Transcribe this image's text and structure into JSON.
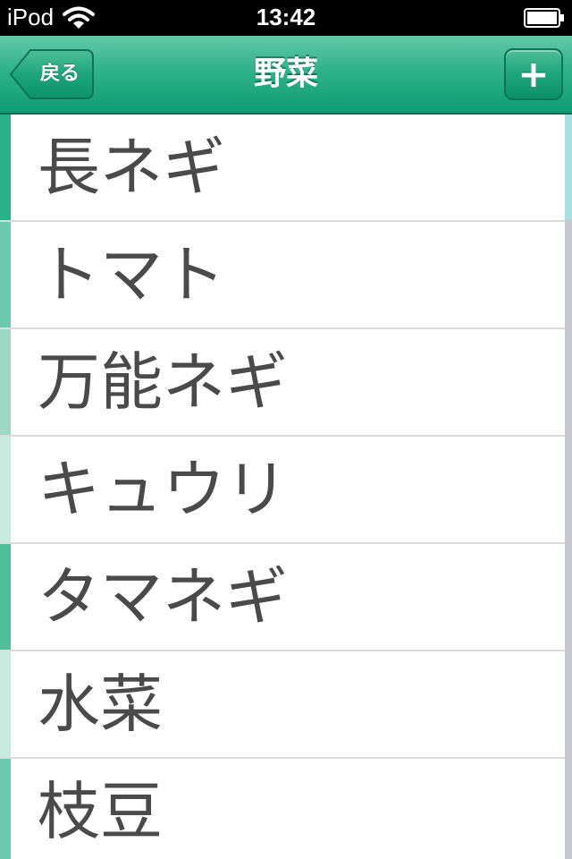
{
  "status_bar": {
    "carrier": "iPod",
    "time": "13:42",
    "icons": [
      "wifi-icon",
      "battery-icon"
    ]
  },
  "nav": {
    "title": "野菜",
    "back_label": "戻る",
    "add_icon": "plus-icon"
  },
  "list": {
    "items": [
      {
        "label": "長ネギ",
        "color": "#25b387"
      },
      {
        "label": "トマト",
        "color": "#6bc9ad"
      },
      {
        "label": "万能ネギ",
        "color": "#9ed9c6"
      },
      {
        "label": "キュウリ",
        "color": "#c8ebe0"
      },
      {
        "label": "タマネギ",
        "color": "#4fbe99"
      },
      {
        "label": "水菜",
        "color": "#c8ebe0"
      },
      {
        "label": "枝豆",
        "color": "#6bc9ad"
      }
    ]
  },
  "colors": {
    "nav_accent": "#1ea57b",
    "scroll_thumb": "#a9dfe0"
  }
}
